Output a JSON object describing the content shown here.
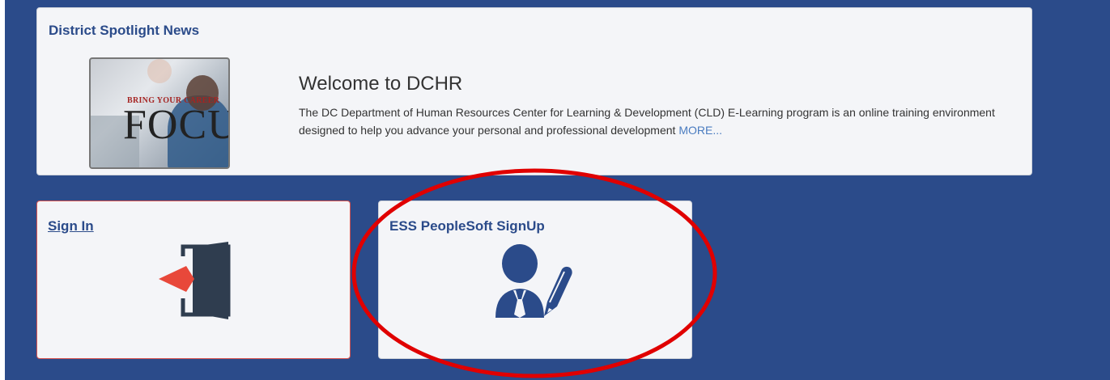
{
  "news": {
    "heading": "District Spotlight News",
    "image_tag": "BRING YOUR CAREER",
    "image_big": "FOCU",
    "title": "Welcome to DCHR",
    "body": "The DC Department of Human Resources Center for Learning & Development (CLD) E-Learning program is an online training environment designed to help you advance your personal and professional development",
    "more_label": "MORE..."
  },
  "tiles": {
    "signin": {
      "label": "Sign In",
      "icon": "door-enter-icon"
    },
    "ess": {
      "label": "ESS PeopleSoft SignUp",
      "icon": "user-pencil-icon"
    }
  },
  "colors": {
    "background": "#2b4b8a",
    "card": "#f4f5f8",
    "heading": "#2b4b8a",
    "link": "#4a7cc0",
    "arrow": "#e8483a",
    "icon_dark": "#2f3d4f",
    "annotation": "#e00000"
  }
}
